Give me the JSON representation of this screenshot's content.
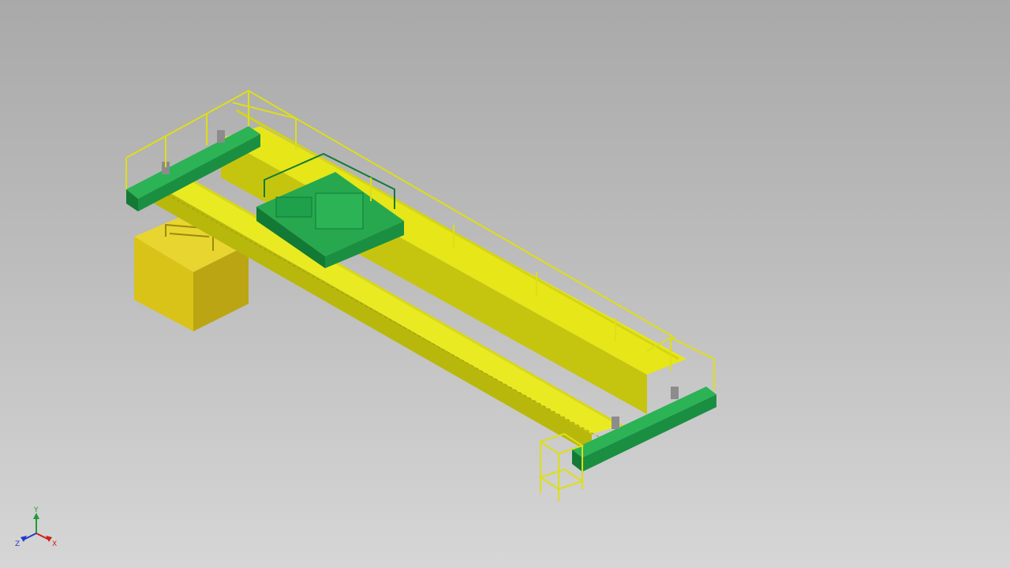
{
  "viewport": {
    "background_top": "#a9a9a9",
    "background_bottom": "#d6d6d6"
  },
  "model": {
    "colors": {
      "yellow": "#e6e619",
      "yellow_dark": "#b8b80c",
      "yellow_side": "#cfcf12",
      "green": "#1fa04a",
      "green_dark": "#137a35",
      "box": "#d9c319",
      "box_dark": "#bba512",
      "grey": "#8c8c8c"
    }
  },
  "triad": {
    "x_label": "X",
    "y_label": "Y",
    "z_label": "Z",
    "x_color": "#cc1f1f",
    "y_color": "#1f9a3a",
    "z_color": "#1f3acc"
  }
}
